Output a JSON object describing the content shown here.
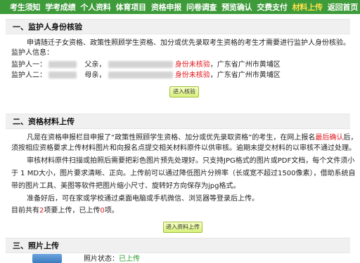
{
  "nav": [
    {
      "label": "考生须知"
    },
    {
      "label": "学考成绩"
    },
    {
      "label": "个人资料"
    },
    {
      "label": "体育项目"
    },
    {
      "label": "资格申报"
    },
    {
      "label": "问卷调查"
    },
    {
      "label": "预览确认"
    },
    {
      "label": "交费支付"
    },
    {
      "label": "材料上传",
      "active": true
    },
    {
      "label": "返回首页"
    }
  ],
  "section1": {
    "title": "一、监护人身份核验",
    "intro": "申请随迁子女资格、政策性照顾学生资格、加分或优先录取考生资格的考生才需要进行监护人身份核验。",
    "info_label": "监护人信息：",
    "rows": [
      {
        "label": "监护人一：",
        "relation": "父亲，",
        "status": "身份未核验",
        "address": "，广东省广州市黄埔区"
      },
      {
        "label": "监护人二：",
        "relation": "母亲，",
        "status": "身份未核验",
        "address": "，广东省广州市黄埔区"
      }
    ],
    "button": "进入核验"
  },
  "section2": {
    "title": "二、资格材料上传",
    "p1_a": "凡是在资格申报栏目申报了“政策性照顾学生资格、加分或优先录取资格”的考生，在网上报名",
    "p1_red": "最后确认",
    "p1_b": "后，",
    "p1_line2": "须按相应资格要求上传材料图片和向报名点提交相关材料原件以供审核。逾期未提交材料的以审核不通过处理。",
    "p2_line1": "审核材料原件扫描或拍照后需要把彩色图片预先处理好。只支持JPG格式的图片或PDF文档，每个文件须小",
    "p2_line2": "于 1 MD大小，图片要求清晰、正向。上传前可以通过降低图片分辨率（长或宽不超过1500像素），借助系统自",
    "p2_line3": "带的图片工具、美图等软件把图片缩小尺寸、旋转好方向保存为jpg格式。",
    "p3": "准备好后，可在家或学校通过桌面电脑或手机微信、浏览器等登录后上传。",
    "summary_a": "目前共有",
    "summary_n1": "2",
    "summary_b": "项要上传，已上传",
    "summary_n2": "0",
    "summary_c": "项。",
    "button": "进入资料上传"
  },
  "section3": {
    "title": "三、照片上传",
    "status_label": "照片状态：",
    "status_value": "已上传"
  },
  "colors": {
    "nav_bg": "#3d9b3a",
    "nav_active": "#ffe24a",
    "alert": "#e0161b",
    "ok": "#2e9b2e"
  }
}
